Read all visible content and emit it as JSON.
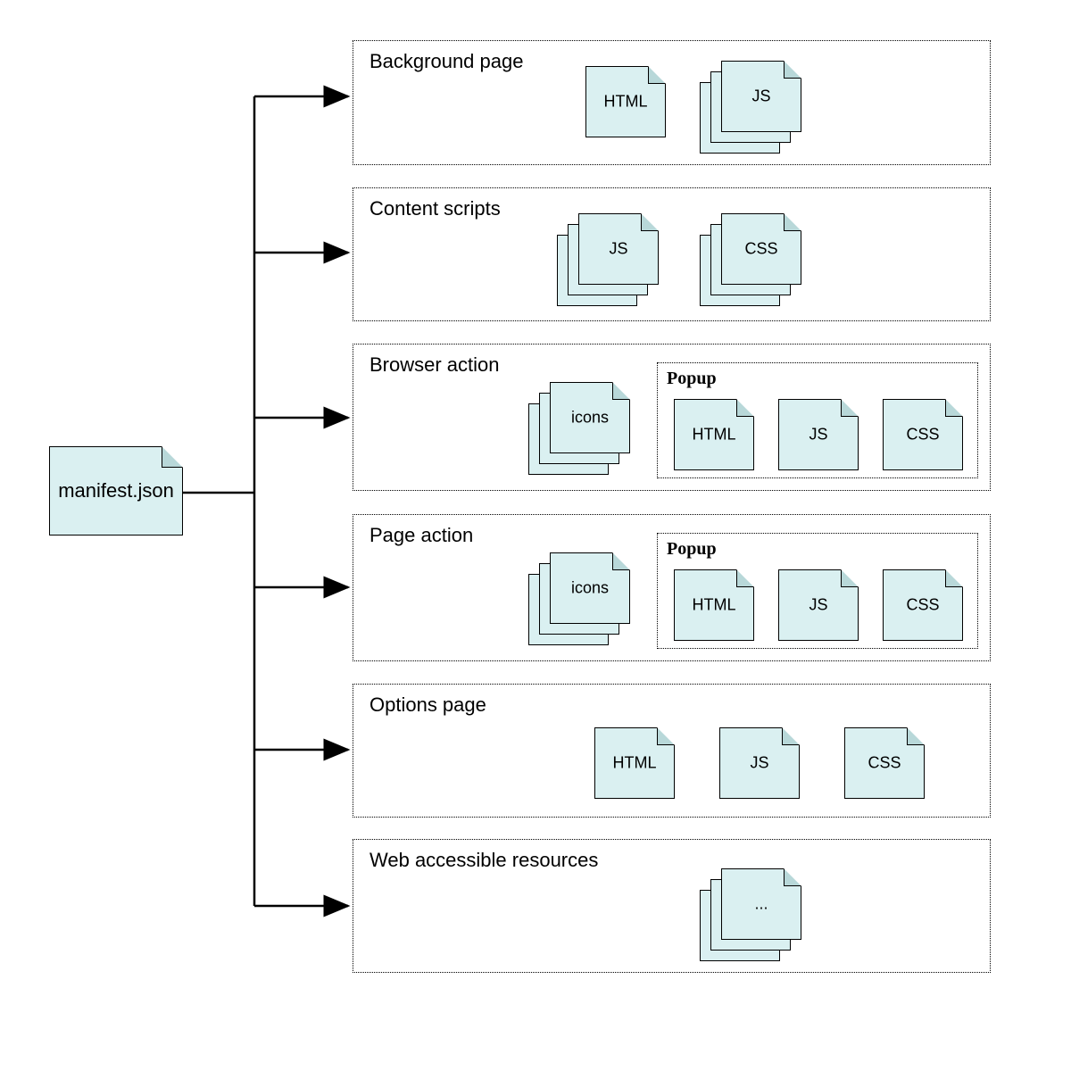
{
  "root": {
    "label": "manifest.json"
  },
  "components": [
    {
      "title": "Background page",
      "files": [
        "HTML",
        "JS"
      ],
      "file_stacks": [
        1,
        3
      ],
      "popup": null
    },
    {
      "title": "Content scripts",
      "files": [
        "JS",
        "CSS"
      ],
      "file_stacks": [
        3,
        3
      ],
      "popup": null
    },
    {
      "title": "Browser action",
      "files": [
        "icons"
      ],
      "file_stacks": [
        3
      ],
      "popup": {
        "title": "Popup",
        "files": [
          "HTML",
          "JS",
          "CSS"
        ],
        "file_stacks": [
          1,
          1,
          1
        ]
      }
    },
    {
      "title": "Page action",
      "files": [
        "icons"
      ],
      "file_stacks": [
        3
      ],
      "popup": {
        "title": "Popup",
        "files": [
          "HTML",
          "JS",
          "CSS"
        ],
        "file_stacks": [
          1,
          1,
          1
        ]
      }
    },
    {
      "title": "Options page",
      "files": [
        "HTML",
        "JS",
        "CSS"
      ],
      "file_stacks": [
        1,
        1,
        1
      ],
      "popup": null
    },
    {
      "title": "Web accessible resources",
      "files": [
        "..."
      ],
      "file_stacks": [
        3
      ],
      "popup": null
    }
  ]
}
